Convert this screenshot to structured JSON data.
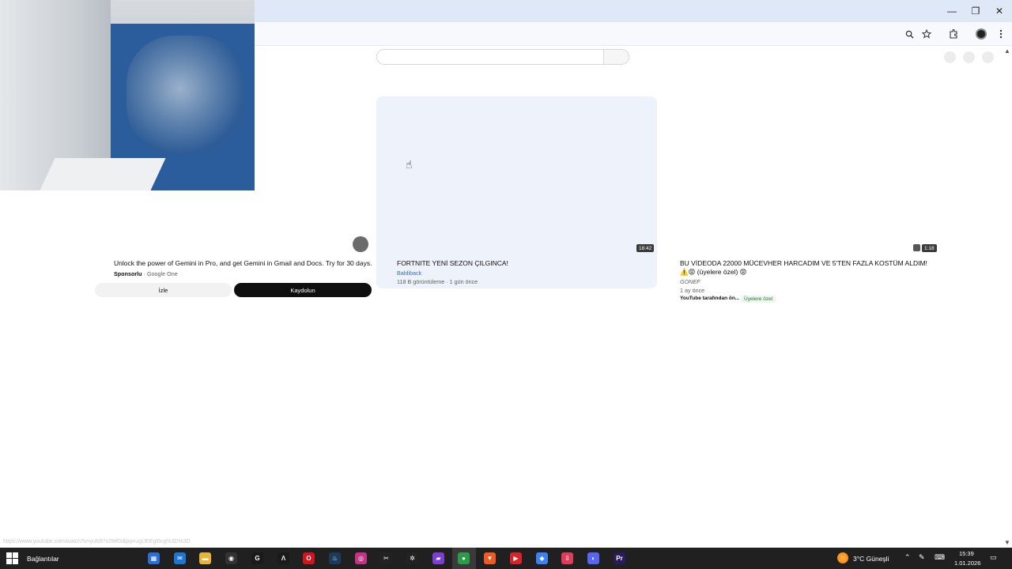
{
  "browser": {
    "window_controls": {
      "minimize": "—",
      "restore": "❐",
      "close": "✕"
    },
    "toolbar_icons": [
      "zoom-icon",
      "star-icon",
      "extensions-icon",
      "profile-icon",
      "menu-icon"
    ]
  },
  "ad": {
    "title": "Unlock the power of Gemini in Pro, and get Gemini in Gmail and Docs. Try for 30 days.",
    "sponsored_label": "Sponsorlu",
    "advertiser": "Google One",
    "watch_button": "İzle",
    "signup_button": "Kaydolun"
  },
  "videos": [
    {
      "title": "FORTNITE YENİ SEZON ÇILGINCA!",
      "channel": "Baldiback",
      "meta": "118 B görüntüleme · 1 gün önce",
      "duration": "18:42"
    },
    {
      "title": "BU VİDEODA 22000 MÜCEVHER HARCADIM VE 5'TEN FAZLA KOSTÜM ALDIM! ⚠️😡 (üyelere özel) 😡",
      "channel": "GONEF",
      "meta": "1 ay önce",
      "note": "YouTube tarafından ön...",
      "badge": "Üyelere özel",
      "duration": "1:18"
    }
  ],
  "status_url": "https://www.youtube.com/watch?v=yuN97v2Mf0I&pp=ugUEEgl0cg%3D%3D",
  "taskbar": {
    "label": "Bağlantılar",
    "weather": "3°C  Güneşli",
    "time": "15:39",
    "date": "1.01.2026",
    "apps": [
      {
        "name": "store-icon",
        "color": "#2b6fd6",
        "glyph": "▦"
      },
      {
        "name": "mail-icon",
        "color": "#1f73d1",
        "glyph": "✉"
      },
      {
        "name": "file-explorer-icon",
        "color": "#e8b53a",
        "glyph": "▬"
      },
      {
        "name": "recorder-icon",
        "color": "#333333",
        "glyph": "◉"
      },
      {
        "name": "g-hub-icon",
        "color": "#1a1a1a",
        "glyph": "G"
      },
      {
        "name": "arch-icon",
        "color": "#1a1a1a",
        "glyph": "Λ"
      },
      {
        "name": "opera-icon",
        "color": "#d4141c",
        "glyph": "O"
      },
      {
        "name": "steam-icon",
        "color": "#1b3a5c",
        "glyph": "♨"
      },
      {
        "name": "instagram-icon",
        "color": "#c13584",
        "glyph": "◎"
      },
      {
        "name": "capcut-icon",
        "color": "#222222",
        "glyph": "✂"
      },
      {
        "name": "chatgpt-icon",
        "color": "#222222",
        "glyph": "✲"
      },
      {
        "name": "notes-icon",
        "color": "#7b3fd1",
        "glyph": "▰"
      },
      {
        "name": "chrome-icon",
        "color": "#2a9d46",
        "glyph": "●"
      },
      {
        "name": "brave-icon",
        "color": "#f05a22",
        "glyph": "▼"
      },
      {
        "name": "videoplayer-icon",
        "color": "#d8232a",
        "glyph": "▶"
      },
      {
        "name": "copilot-icon",
        "color": "#3b82f6",
        "glyph": "◆"
      },
      {
        "name": "downloader-icon",
        "color": "#e23a5a",
        "glyph": "⇩"
      },
      {
        "name": "discord-icon",
        "color": "#5865f2",
        "glyph": "◐"
      },
      {
        "name": "premiere-icon",
        "color": "#2a1b5e",
        "glyph": "Pr"
      }
    ]
  }
}
